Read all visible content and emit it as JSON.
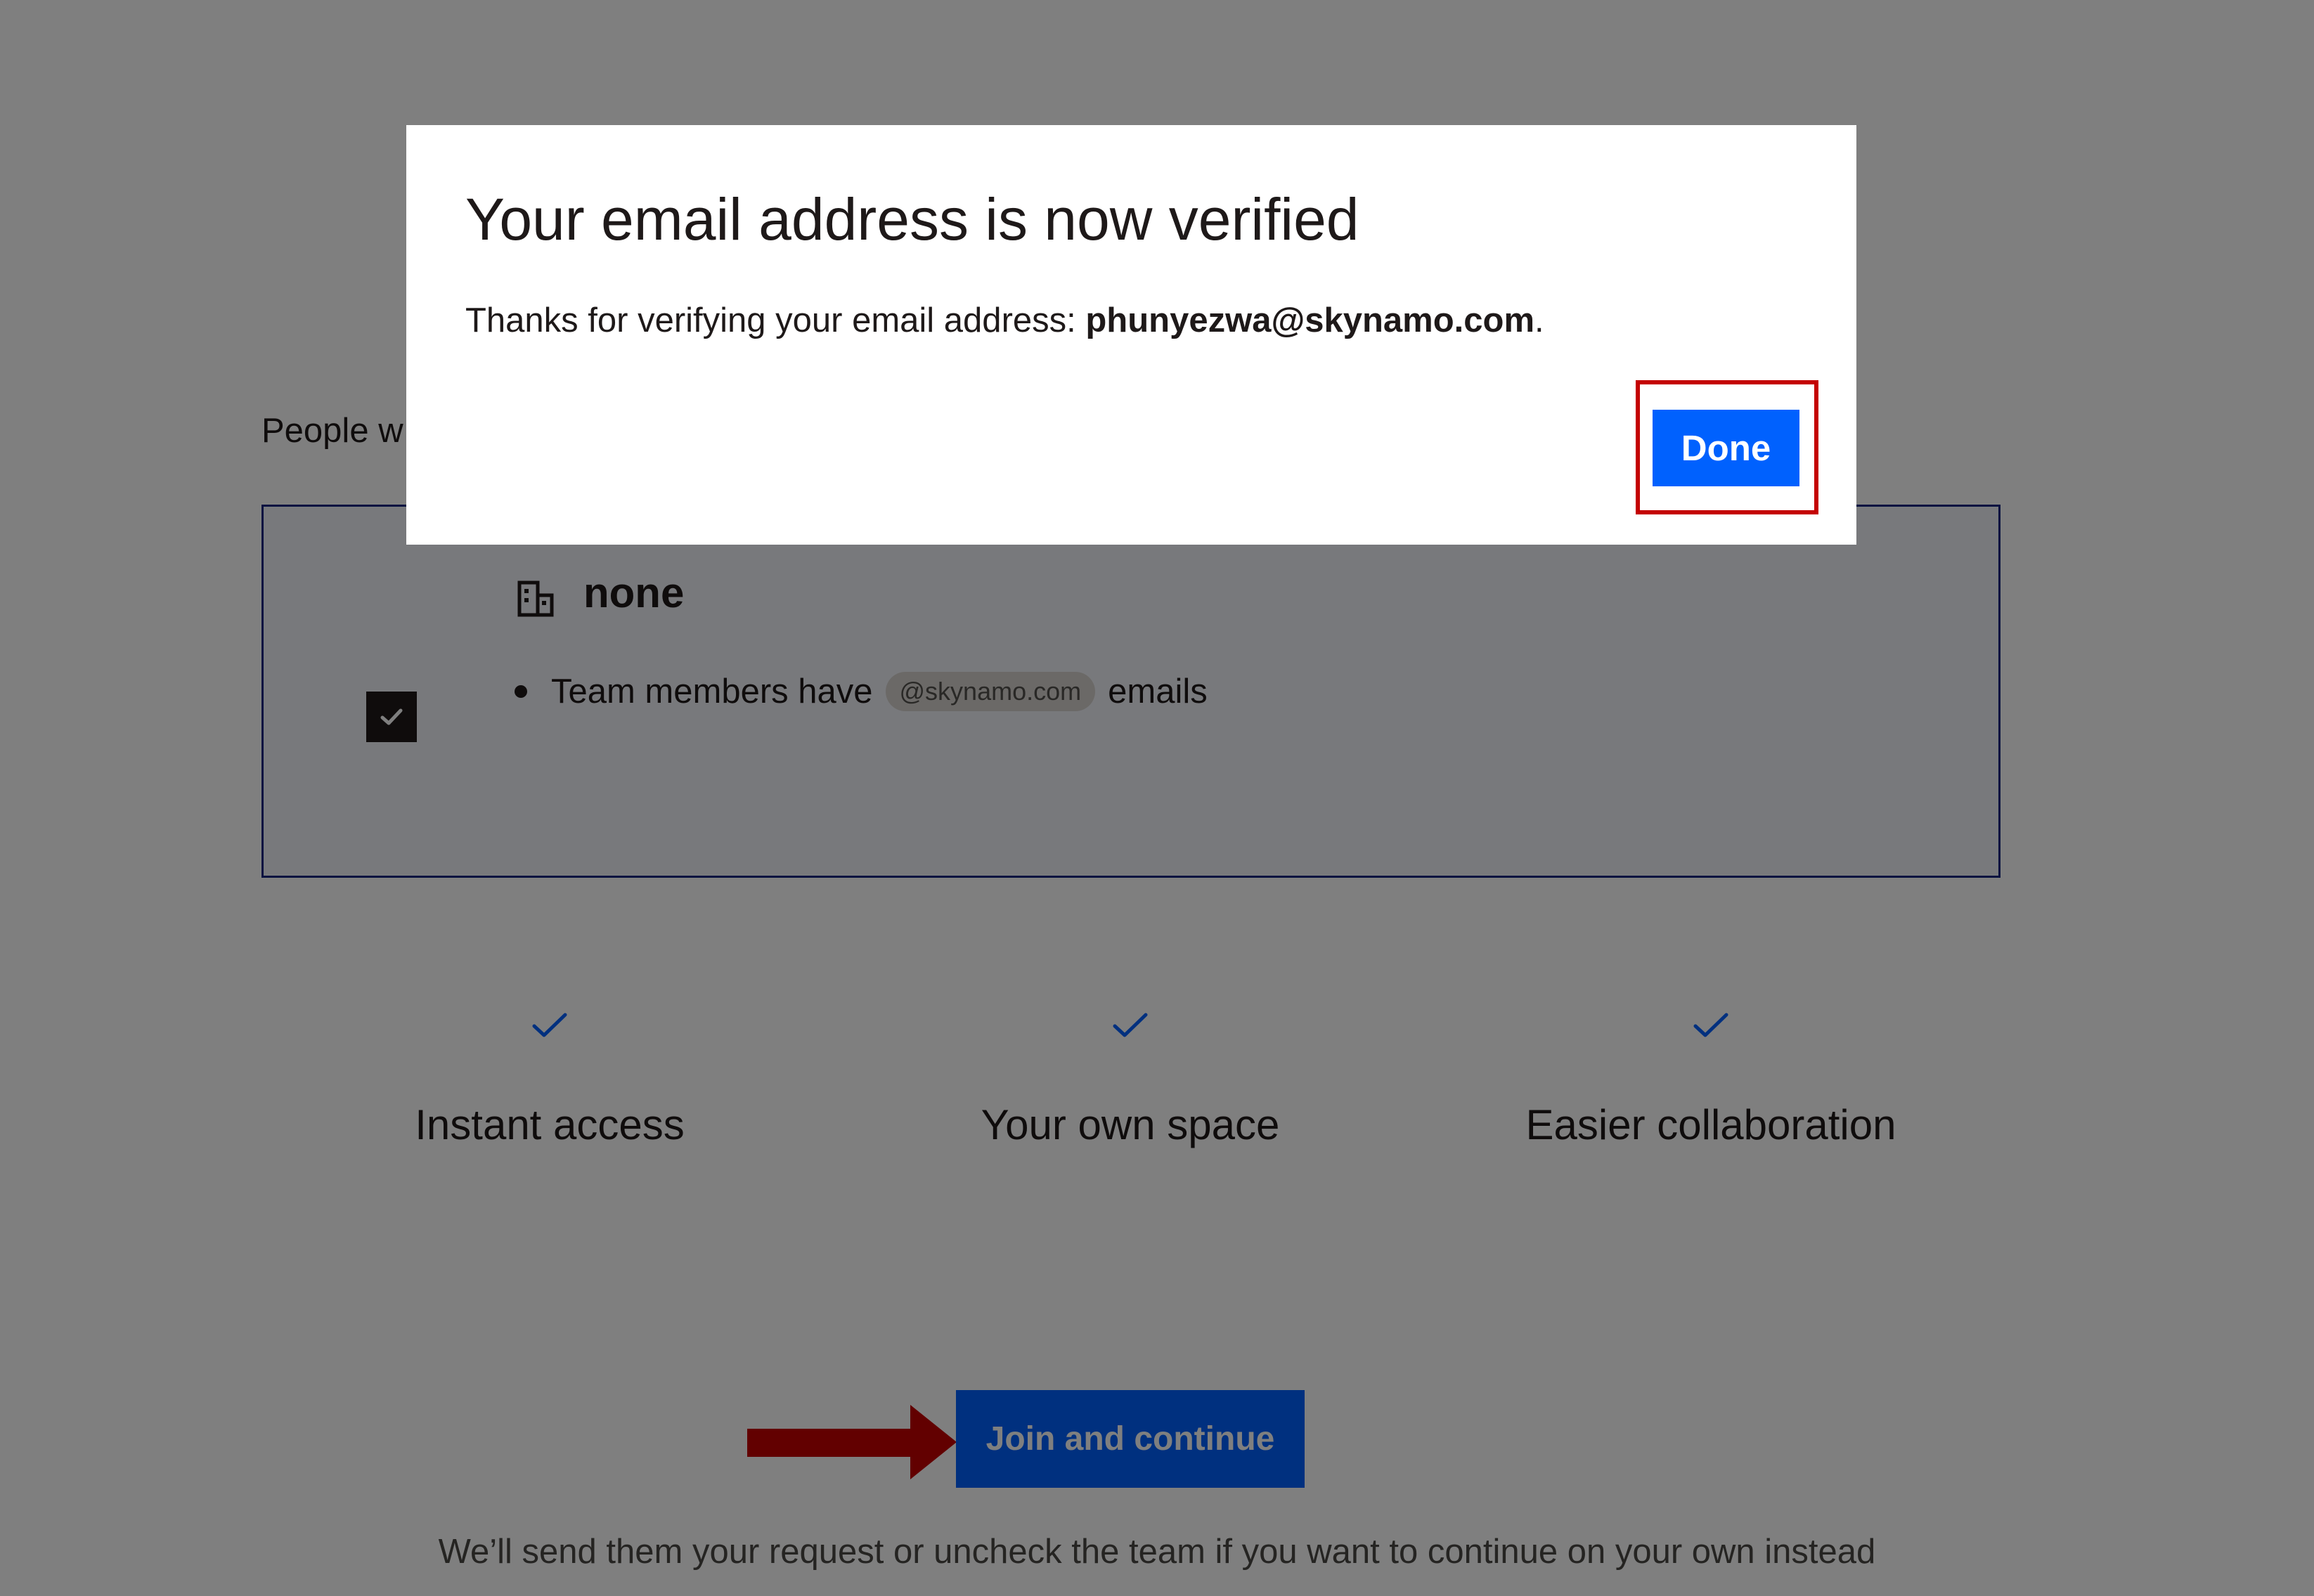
{
  "intro_text": "People w",
  "team": {
    "name": "none",
    "bullet_prefix": "Team members have",
    "domain": "@skynamo.com",
    "bullet_suffix": "emails",
    "checked": true
  },
  "benefits": [
    {
      "label": "Instant access",
      "icon": "check-icon"
    },
    {
      "label": "Your own space",
      "icon": "check-icon"
    },
    {
      "label": "Easier collaboration",
      "icon": "check-icon"
    }
  ],
  "join_button": "Join and continue",
  "footer_note": "We’ll send them your request or uncheck the team if you want to continue on your own instead",
  "modal": {
    "title": "Your email address is now verified",
    "body_prefix": "Thanks for verifying your email address: ",
    "email": "phunyezwa@skynamo.com",
    "body_suffix": ".",
    "done_button": "Done"
  },
  "colors": {
    "accent": "#0061fe",
    "highlight": "#c40000",
    "card_border": "#0d2481",
    "overlay": "rgba(0,0,0,0.5)"
  }
}
